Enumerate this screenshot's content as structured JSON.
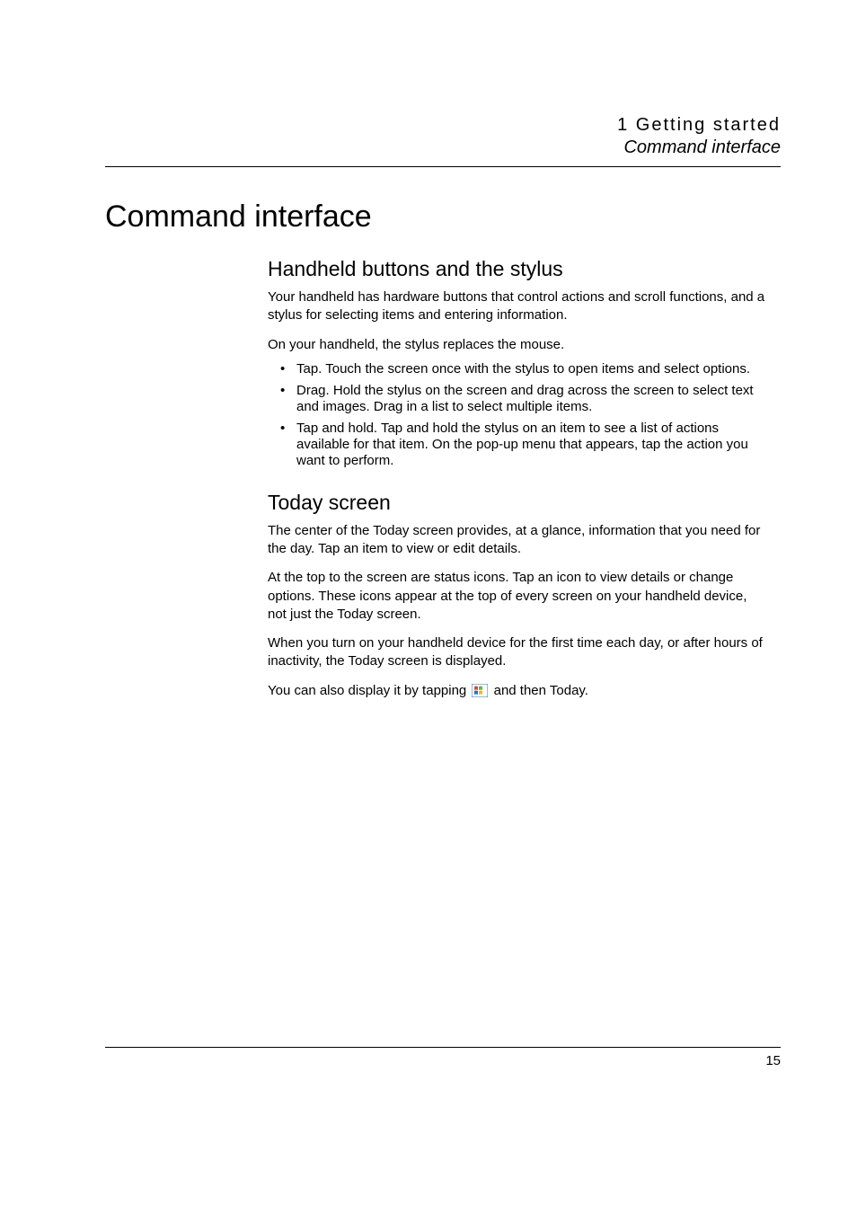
{
  "header": {
    "chapter": "1 Getting started",
    "section": "Command interface"
  },
  "main_heading": "Command interface",
  "subsections": [
    {
      "heading": "Handheld buttons and the stylus",
      "paragraphs": [
        "Your handheld has hardware buttons that control actions and scroll functions, and a stylus for selecting items and entering information.",
        "On your handheld, the stylus replaces the mouse."
      ],
      "bullets": [
        "Tap. Touch the screen once with the stylus to open items and select options.",
        "Drag. Hold the stylus on the screen and drag across the screen to select text and images. Drag in a list to select multiple items.",
        "Tap and hold. Tap and hold the stylus on an item to see a list of actions available for that item. On the pop-up menu that appears, tap the action you want to perform."
      ]
    },
    {
      "heading": "Today screen",
      "paragraphs": [
        "The center of the Today screen provides, at a glance, information that you need for the day. Tap an item to view or edit details.",
        "At the top to the screen are status icons. Tap an icon to view details or change options. These icons appear at the top of every screen on your handheld device, not just the Today screen.",
        "When you turn on your handheld device for the first time each day, or after hours of inactivity, the Today screen is displayed."
      ],
      "last_line_before": "You can also display it by tapping ",
      "last_line_after": " and then Today."
    }
  ],
  "page_number": "15"
}
